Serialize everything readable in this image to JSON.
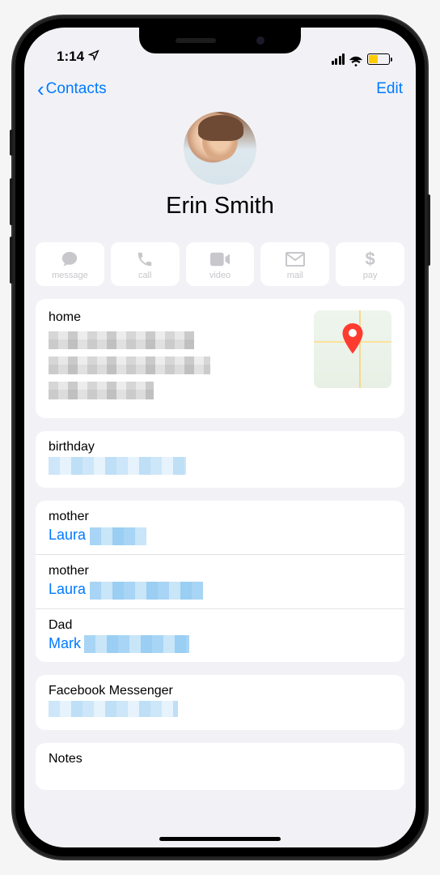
{
  "status": {
    "time": "1:14"
  },
  "nav": {
    "back_label": "Contacts",
    "edit_label": "Edit"
  },
  "contact": {
    "name": "Erin Smith"
  },
  "actions": [
    {
      "id": "message",
      "label": "message"
    },
    {
      "id": "call",
      "label": "call"
    },
    {
      "id": "video",
      "label": "video"
    },
    {
      "id": "mail",
      "label": "mail"
    },
    {
      "id": "pay",
      "label": "pay"
    }
  ],
  "address": {
    "label": "home"
  },
  "fields": {
    "birthday_label": "birthday",
    "mother1_label": "mother",
    "mother1_name": "Laura",
    "mother2_label": "mother",
    "mother2_name": "Laura",
    "dad_label": "Dad",
    "dad_name": "Mark",
    "fm_label": "Facebook Messenger",
    "notes_label": "Notes"
  }
}
